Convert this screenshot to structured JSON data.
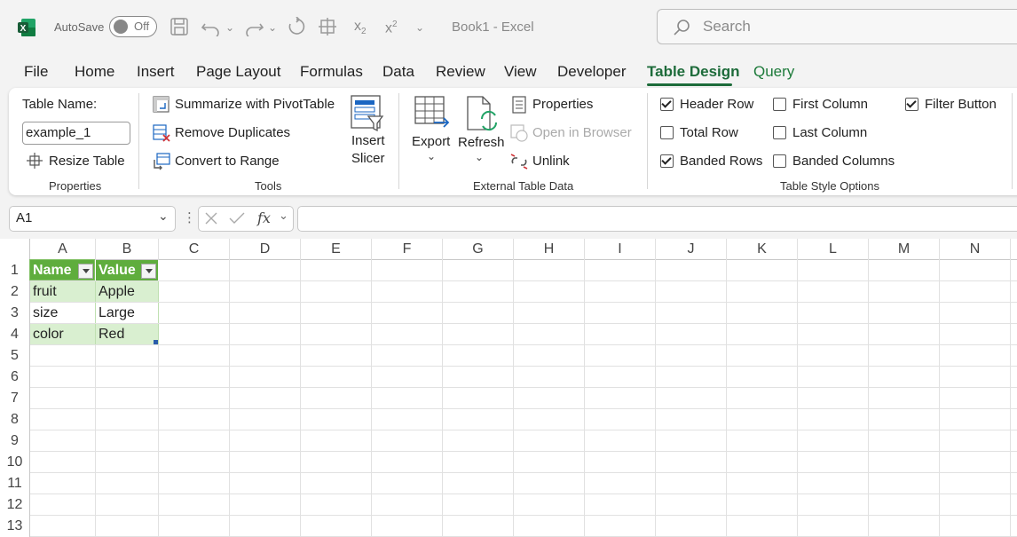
{
  "titlebar": {
    "autosave_label": "AutoSave",
    "autosave_state": "Off",
    "doc_title": "Book1  -  Excel",
    "search_placeholder": "Search"
  },
  "tabs": [
    "File",
    "Home",
    "Insert",
    "Page Layout",
    "Formulas",
    "Data",
    "Review",
    "View",
    "Developer",
    "Table Design",
    "Query"
  ],
  "active_tab": "Table Design",
  "ribbon": {
    "properties": {
      "table_name_label": "Table Name:",
      "table_name_value": "example_1",
      "resize": "Resize Table",
      "group": "Properties"
    },
    "tools": {
      "pivot": "Summarize with PivotTable",
      "remove_dup": "Remove Duplicates",
      "convert": "Convert to Range",
      "slicer_1": "Insert",
      "slicer_2": "Slicer",
      "group": "Tools"
    },
    "external": {
      "export": "Export",
      "refresh": "Refresh",
      "properties": "Properties",
      "open_browser": "Open in Browser",
      "unlink": "Unlink",
      "group": "External Table Data"
    },
    "style_options": {
      "header_row": "Header Row",
      "total_row": "Total Row",
      "banded_rows": "Banded Rows",
      "first_column": "First Column",
      "last_column": "Last Column",
      "banded_columns": "Banded Columns",
      "filter_button": "Filter Button",
      "group": "Table Style Options"
    }
  },
  "formula_bar": {
    "name_box": "A1",
    "fx": "fx",
    "formula": ""
  },
  "columns": [
    "A",
    "B",
    "C",
    "D",
    "E",
    "F",
    "G",
    "H",
    "I",
    "J",
    "K",
    "L",
    "M",
    "N"
  ],
  "rows": [
    "1",
    "2",
    "3",
    "4",
    "5",
    "6",
    "7",
    "8",
    "9",
    "10",
    "11",
    "12",
    "13"
  ],
  "table": {
    "headers": [
      "Name",
      "Value"
    ],
    "data": [
      [
        "fruit",
        "Apple"
      ],
      [
        "size",
        "Large"
      ],
      [
        "color",
        "Red"
      ]
    ]
  },
  "colors": {
    "accent": "#1d6b3a",
    "table_header": "#5fad3d",
    "band": "#d9efd0"
  }
}
